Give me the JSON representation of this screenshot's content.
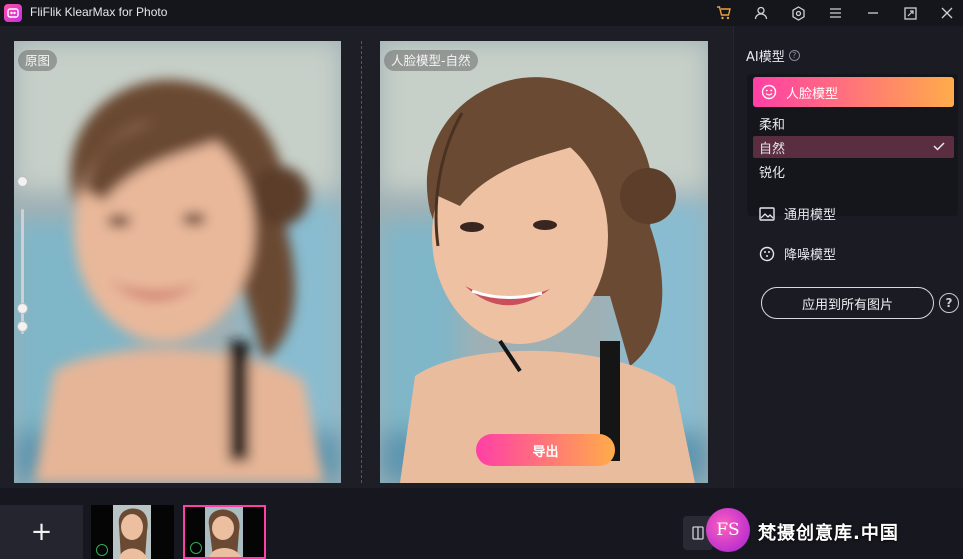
{
  "app": {
    "title": "FliFlik KlearMax for Photo",
    "logo_icon": "app-logo-icon"
  },
  "titlebar": {
    "icons": [
      "cart-icon",
      "user-icon",
      "settings-icon",
      "menu-icon",
      "minimize-icon",
      "maximize-icon",
      "close-icon"
    ],
    "cart_color": "#e8a33c"
  },
  "preview": {
    "left_label": "原图",
    "right_label": "人脸模型-自然",
    "export_label": "导出",
    "accent_gradient": [
      "#ff3fa6",
      "#ffac4a"
    ]
  },
  "sidebar": {
    "title": "AI模型",
    "face_model": {
      "label": "人脸模型",
      "options": [
        {
          "label": "柔和",
          "selected": false
        },
        {
          "label": "自然",
          "selected": true
        },
        {
          "label": "锐化",
          "selected": false
        }
      ]
    },
    "general_model": "通用模型",
    "denoise_model": "降噪模型",
    "apply_all": "应用到所有图片"
  },
  "bottom": {
    "add_label": "+",
    "thumbnails": [
      {
        "active": false
      },
      {
        "active": true
      }
    ]
  },
  "watermark": {
    "logo_text": "FS",
    "text": "梵摄创意库.中国"
  }
}
